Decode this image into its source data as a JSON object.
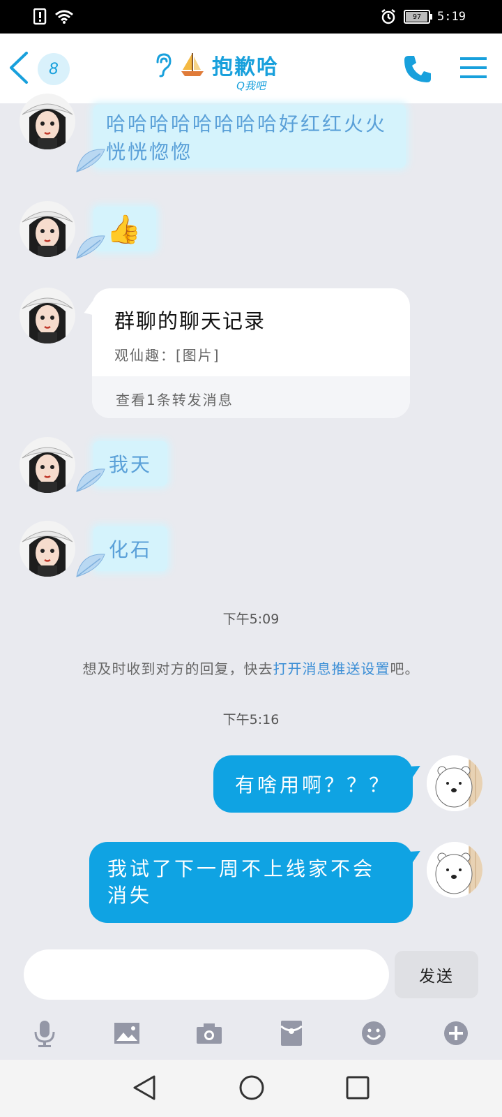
{
  "status_bar": {
    "battery": "97",
    "time": "5:19"
  },
  "header": {
    "unread_count": "8",
    "title": "抱歉哈",
    "subtitle": "Q我吧"
  },
  "messages_in": {
    "msg1": "哈哈哈哈哈哈哈哈好红红火火恍恍惚惚",
    "msg2_emoji": "👍",
    "forward_card": {
      "title": "群聊的聊天记录",
      "line": "观仙趣：[图片]",
      "footer": "查看1条转发消息"
    },
    "msg4": "我天",
    "msg5": "化石"
  },
  "timestamps": {
    "t1": "下午5:09",
    "t2": "下午5:16"
  },
  "notice": {
    "prefix": "想及时收到对方的回复，快去",
    "link": "打开消息推送设置",
    "suffix": "吧。"
  },
  "messages_out": {
    "msg1": "有啥用啊？？？",
    "msg2": "我试了下一周不上线家不会消失"
  },
  "input": {
    "placeholder": "",
    "send_label": "发送"
  },
  "colors": {
    "accent": "#18a0dc",
    "bubble_out": "#0fa3e3",
    "bubble_in": "#d5f3fc",
    "background": "#e9eaef"
  }
}
